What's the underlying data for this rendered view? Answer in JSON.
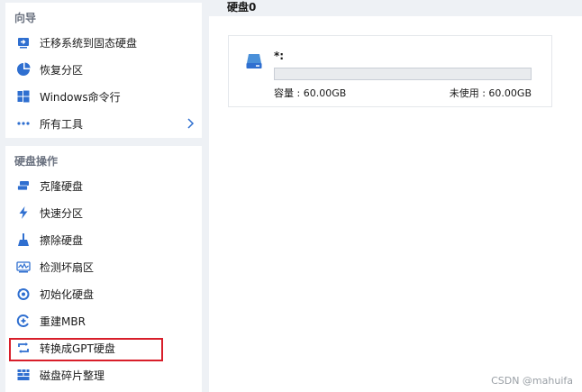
{
  "sidebar": {
    "guide": {
      "title": "向导",
      "items": [
        {
          "label": "迁移系统到固态硬盘",
          "icon": "migrate-os-icon"
        },
        {
          "label": "恢复分区",
          "icon": "recover-partition-icon"
        },
        {
          "label": "Windows命令行",
          "icon": "windows-icon"
        },
        {
          "label": "所有工具",
          "icon": "more-dots-icon"
        }
      ]
    },
    "disk_ops": {
      "title": "硬盘操作",
      "items": [
        {
          "label": "克隆硬盘",
          "icon": "clone-disk-icon"
        },
        {
          "label": "快速分区",
          "icon": "lightning-icon"
        },
        {
          "label": "擦除硬盘",
          "icon": "broom-icon"
        },
        {
          "label": "检测坏扇区",
          "icon": "bad-sector-icon"
        },
        {
          "label": "初始化硬盘",
          "icon": "initialize-icon"
        },
        {
          "label": "重建MBR",
          "icon": "rebuild-mbr-icon"
        },
        {
          "label": "转换成GPT硬盘",
          "icon": "convert-gpt-icon"
        },
        {
          "label": "磁盘碎片整理",
          "icon": "defrag-icon"
        }
      ]
    }
  },
  "main": {
    "title": "硬盘0",
    "disk": {
      "name": "*:",
      "used_fraction": 0.0,
      "capacity_label": "容量 : 60.00GB",
      "unused_label": "未使用 : 60.00GB"
    }
  },
  "watermark": "CSDN @mahuifa",
  "colors": {
    "accent": "#2f6fd0",
    "highlight": "#d81e2a",
    "sidebar_bg": "#eef1f5"
  }
}
